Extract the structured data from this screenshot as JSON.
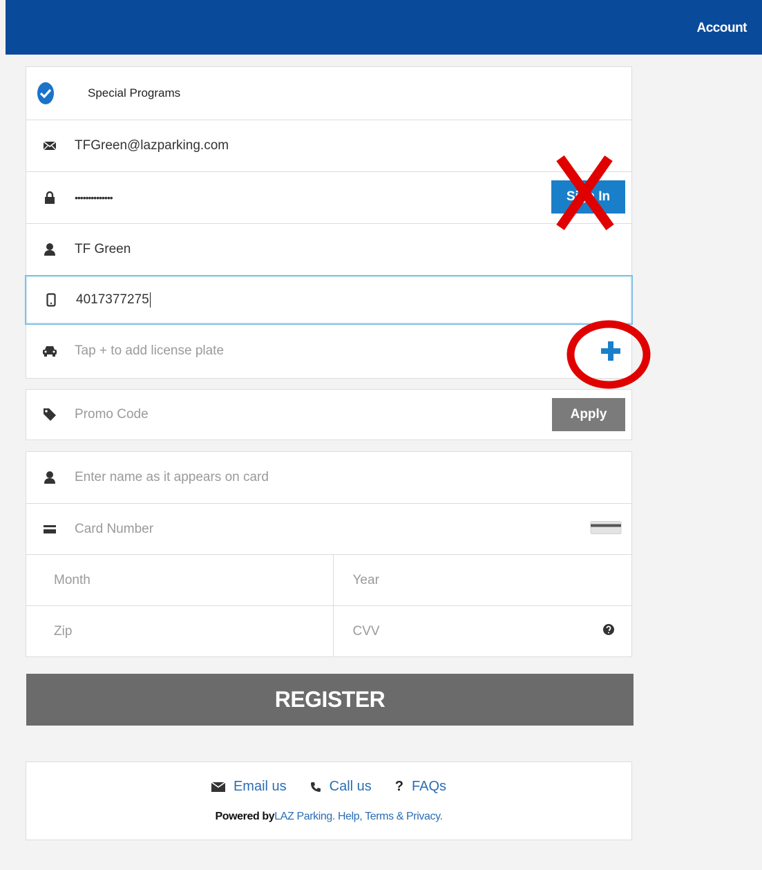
{
  "header": {
    "account_label": "Account",
    "bar_color": "#0a4a9a"
  },
  "form": {
    "special_programs": "Special Programs",
    "email_value": "TFGreen@lazparking.com",
    "password_value": "••••••••••••••",
    "sign_in_label": "Sign In",
    "name_value": "TF Green",
    "phone_value": "4017377275",
    "plate_placeholder": "Tap + to add license plate",
    "promo_placeholder": "Promo Code",
    "apply_label": "Apply",
    "card_name_placeholder": "Enter name as it appears on card",
    "card_number_placeholder": "Card Number",
    "month_placeholder": "Month",
    "year_placeholder": "Year",
    "zip_placeholder": "Zip",
    "cvv_placeholder": "CVV",
    "register_label": "REGISTER"
  },
  "footer": {
    "email_us": "Email us",
    "call_us": "Call us",
    "faqs": "FAQs",
    "powered_by": "Powered by",
    "laz_parking": "LAZ Parking",
    "sep1": ".",
    "help": "Help",
    "sep2": ",",
    "terms": "Terms & Privacy",
    "sep3": "."
  },
  "icons": {
    "check": "check-circle-icon",
    "email": "envelope-icon",
    "password": "lock-icon",
    "name": "user-icon",
    "phone": "mobile-phone-icon",
    "vehicle": "car-icon",
    "plate_add": "plus-icon",
    "promo": "tag-icon",
    "card": "credit-card-icon",
    "cvv_help": "question-circle-icon"
  },
  "annotations": {
    "accent_red": "#e00000",
    "x_mark": "red-x-mark",
    "circle_mark": "red-circle-mark"
  }
}
